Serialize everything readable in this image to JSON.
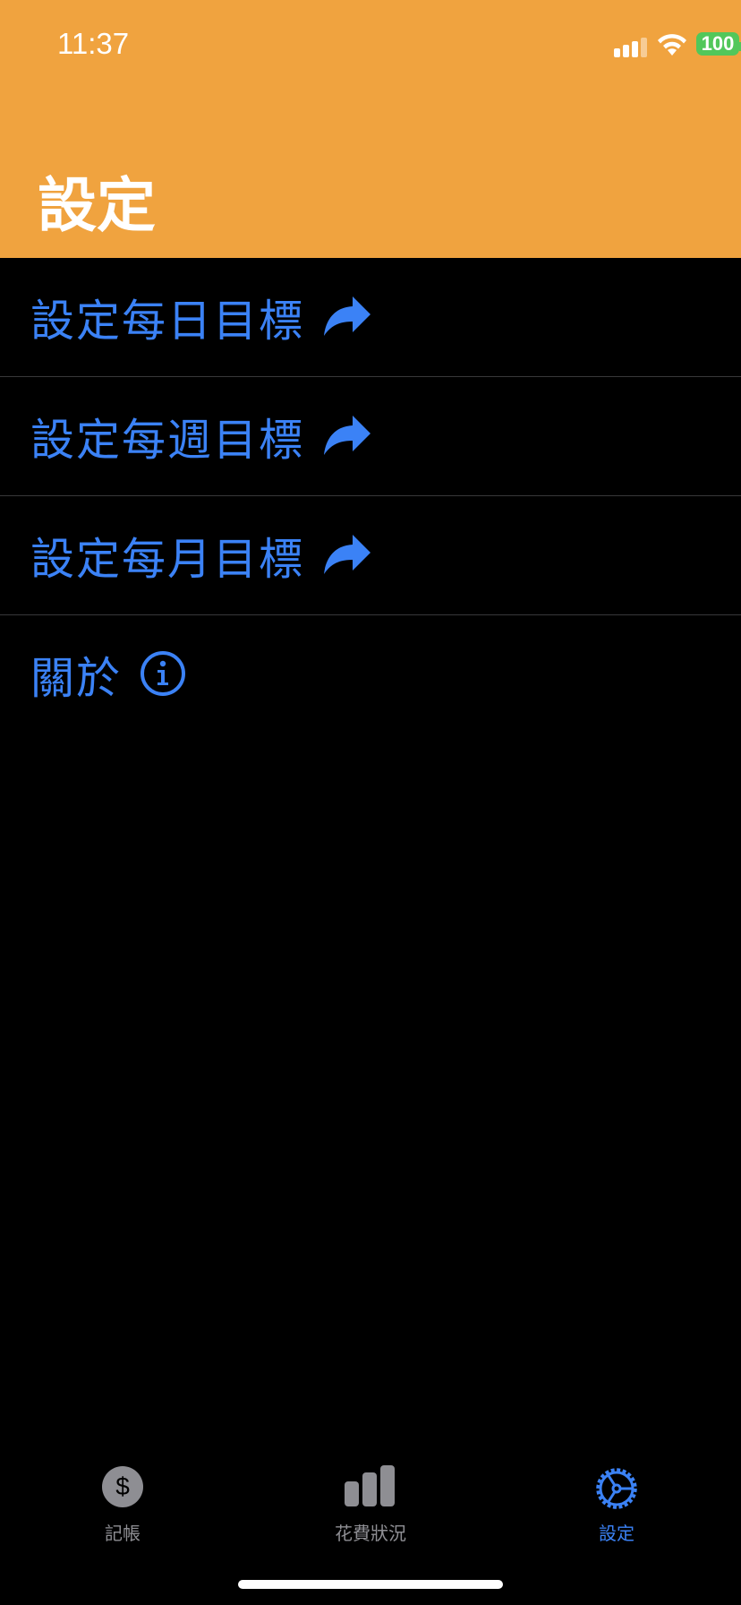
{
  "status_bar": {
    "time": "11:37",
    "battery": "100"
  },
  "header": {
    "title": "設定",
    "background": "#F0A33F"
  },
  "settings": {
    "items": [
      {
        "label": "設定每日目標",
        "icon": "share-arrow-icon"
      },
      {
        "label": "設定每週目標",
        "icon": "share-arrow-icon"
      },
      {
        "label": "設定每月目標",
        "icon": "share-arrow-icon"
      },
      {
        "label": "關於",
        "icon": "info-circle-icon"
      }
    ]
  },
  "tabbar": {
    "tabs": [
      {
        "label": "記帳",
        "icon": "dollar-circle-icon",
        "active": false
      },
      {
        "label": "花費狀況",
        "icon": "bar-chart-icon",
        "active": false
      },
      {
        "label": "設定",
        "icon": "gear-icon",
        "active": true
      }
    ]
  },
  "colors": {
    "accent": "#3B82F6",
    "inactive": "#8E8E93",
    "battery": "#52C75A"
  }
}
